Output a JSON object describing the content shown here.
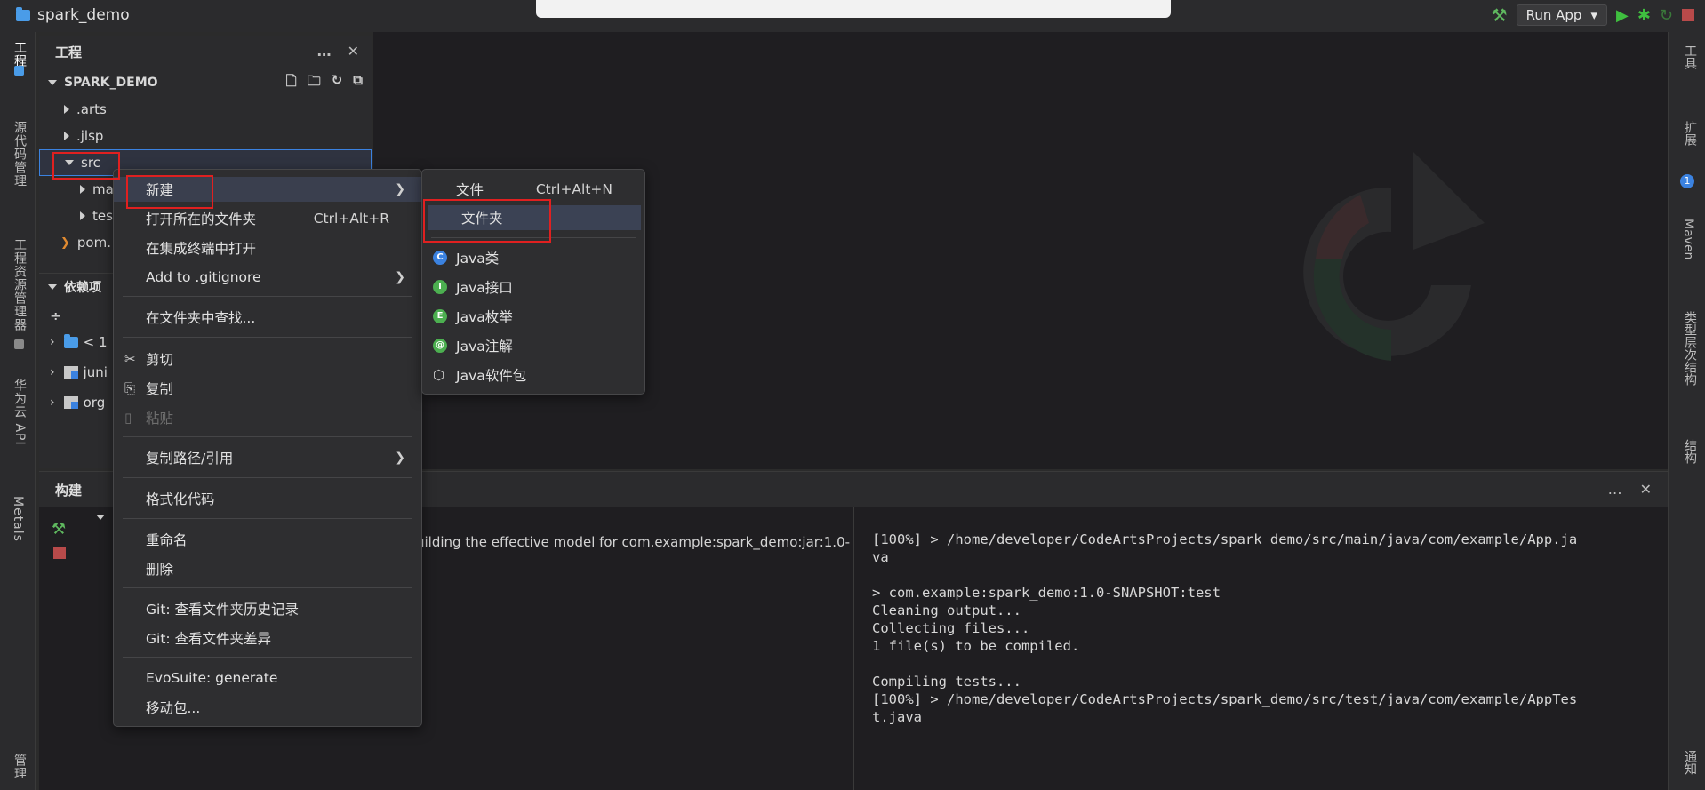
{
  "titlebar": {
    "project_name": "spark_demo",
    "run_config": "Run App"
  },
  "leftbar": {
    "tabs": [
      "工程",
      "源代码管理",
      "工程资源管理器",
      "华为云 API",
      "Metals",
      "管理"
    ]
  },
  "rightbar": {
    "tabs": [
      "工具",
      "扩展",
      "Maven",
      "类型层次结构",
      "结构",
      "通知"
    ],
    "extensions_badge": "1"
  },
  "project_panel": {
    "title": "工程",
    "more_icon": "…",
    "close_icon": "✕",
    "root": "SPARK_DEMO",
    "items": [
      ".arts",
      ".jlsp",
      "src",
      "ma",
      "tes",
      "pom."
    ],
    "dependencies_title": "依赖项",
    "dep_items": [
      "< 1",
      "juni",
      "org"
    ]
  },
  "build_panel": {
    "title": "构建",
    "message": "uilding the effective model for com.example:spark_demo:jar:1.0-",
    "console_lines": [
      "[100%] > /home/developer/CodeArtsProjects/spark_demo/src/main/java/com/example/App.ja",
      "va",
      "",
      "> com.example:spark_demo:1.0-SNAPSHOT:test",
      "Cleaning output...",
      "Collecting files...",
      "1 file(s) to be compiled.",
      "",
      "Compiling tests...",
      "[100%] > /home/developer/CodeArtsProjects/spark_demo/src/test/java/com/example/AppTes",
      "t.java"
    ]
  },
  "context_menu": {
    "new": "新建",
    "open_folder": "打开所在的文件夹",
    "open_folder_shortcut": "Ctrl+Alt+R",
    "open_terminal": "在集成终端中打开",
    "add_gitignore": "Add to .gitignore",
    "find_in_folder": "在文件夹中查找...",
    "cut": "剪切",
    "copy": "复制",
    "paste": "粘贴",
    "copy_path": "复制路径/引用",
    "format_code": "格式化代码",
    "rename": "重命名",
    "delete": "删除",
    "git_history": "Git: 查看文件夹历史记录",
    "git_diff": "Git: 查看文件夹差异",
    "evosuite": "EvoSuite: generate",
    "move_package": "移动包..."
  },
  "submenu": {
    "file": "文件",
    "file_shortcut": "Ctrl+Alt+N",
    "folder": "文件夹",
    "java_class": "Java类",
    "java_interface": "Java接口",
    "java_enum": "Java枚举",
    "java_annotation": "Java注解",
    "java_package": "Java软件包",
    "icon_colors": {
      "class": "#3b82e0",
      "interface": "#4caf50",
      "enum": "#4caf50",
      "annotation": "#4caf50"
    }
  }
}
